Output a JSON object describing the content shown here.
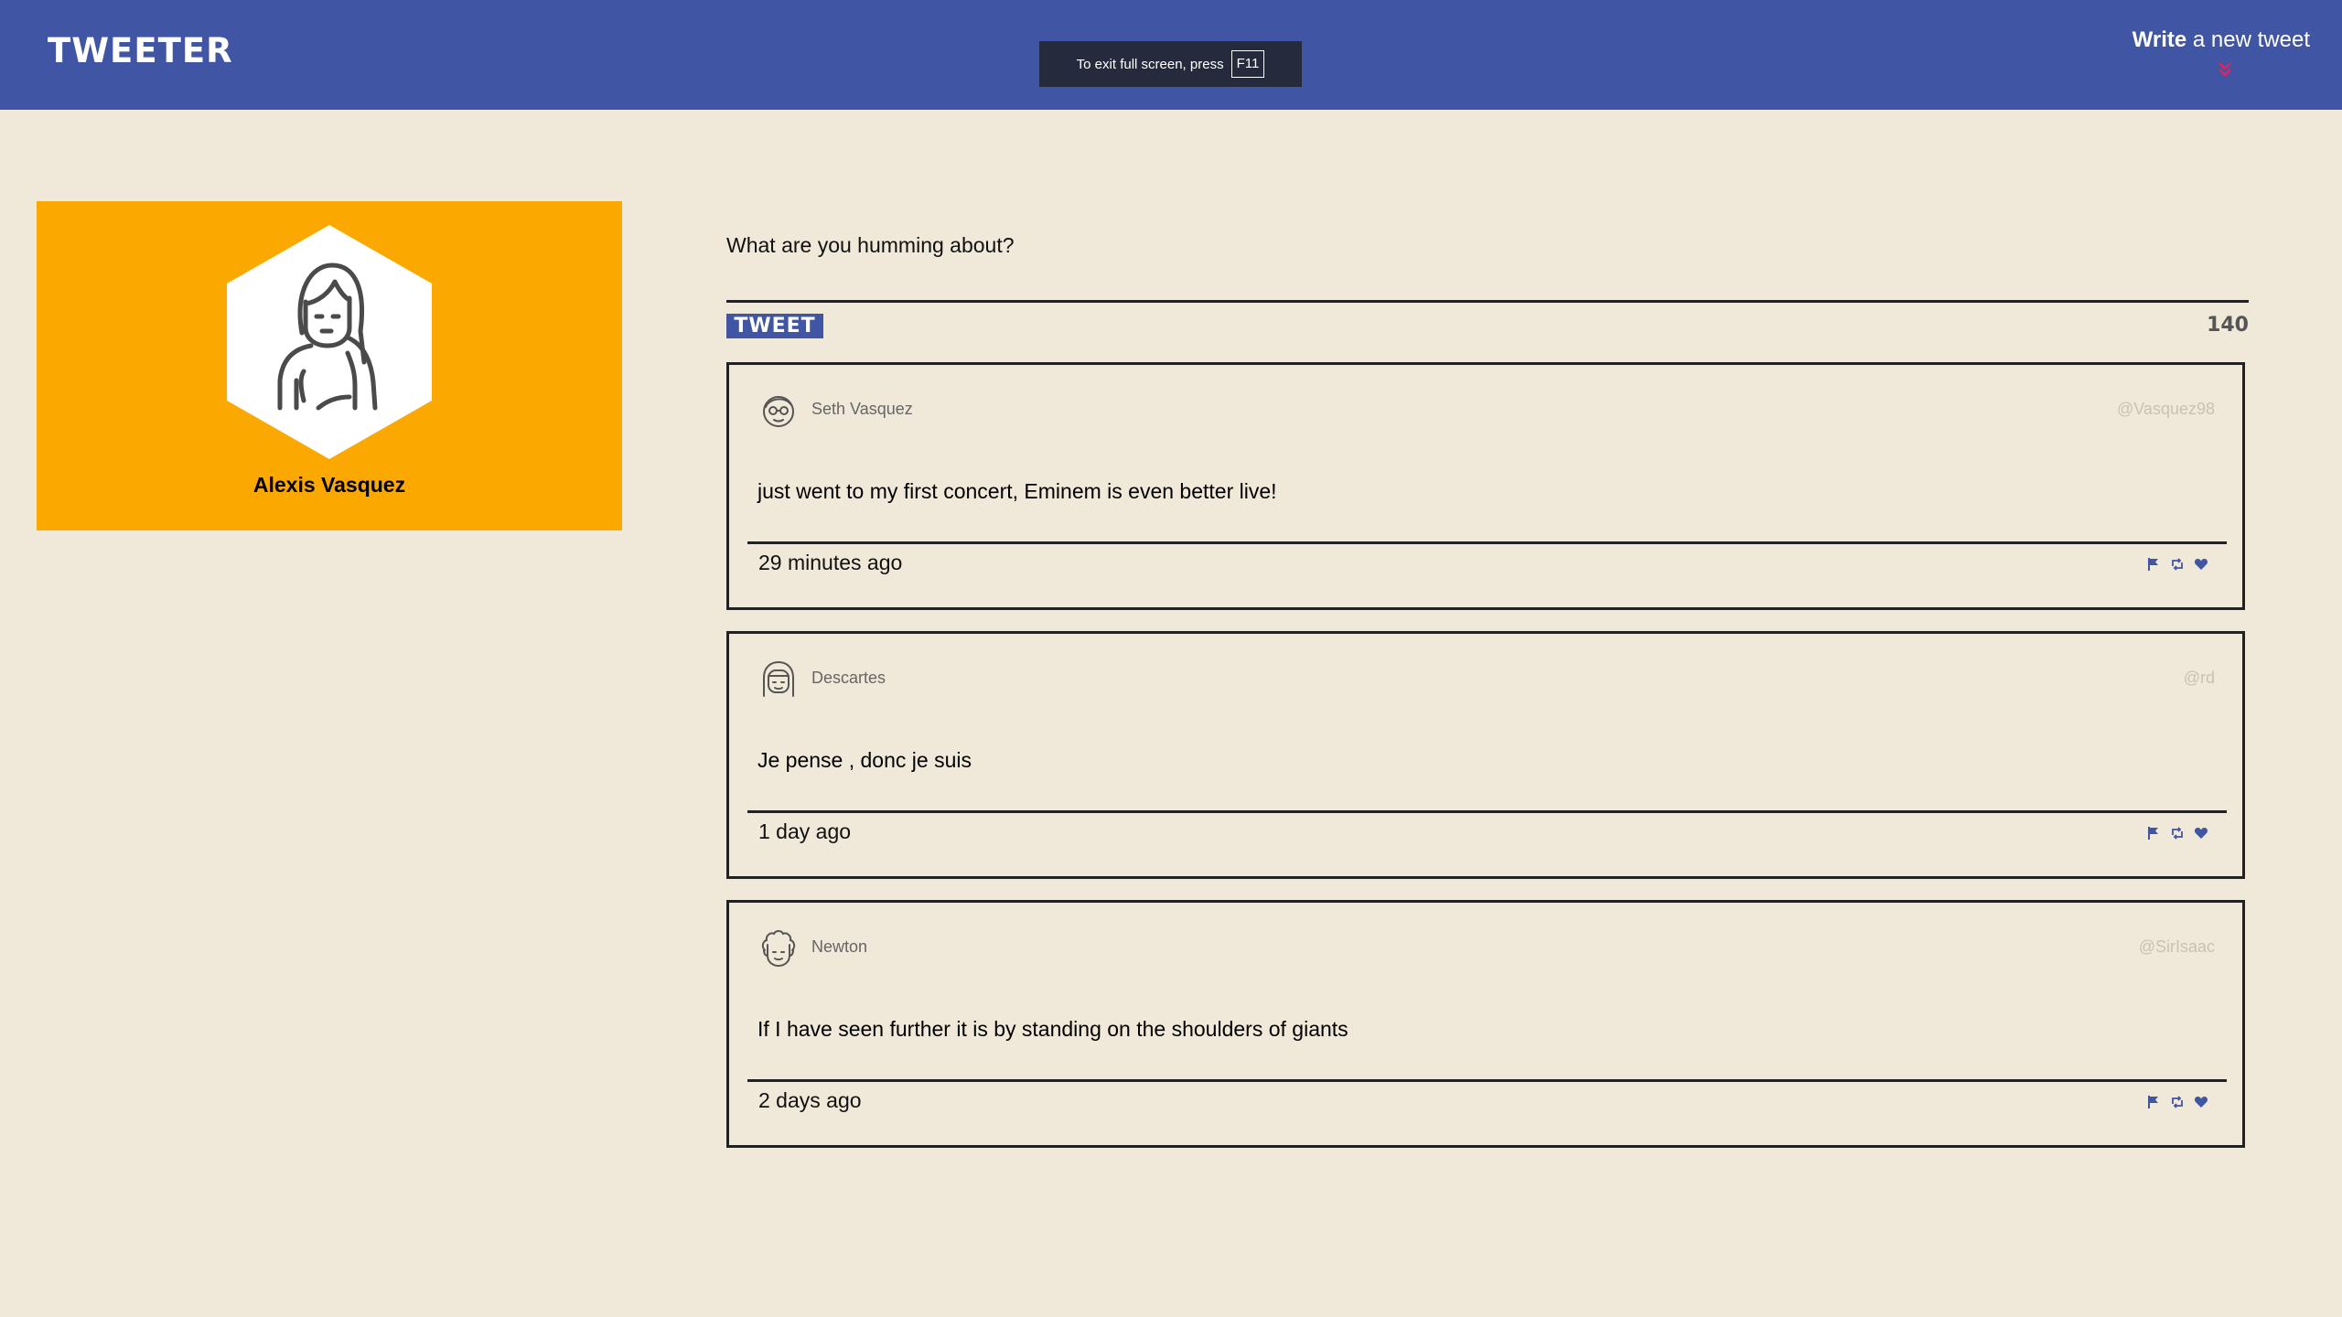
{
  "header": {
    "logo": "TWEETER",
    "fullscreen_notice": "To exit full screen, press",
    "fullscreen_key": "F11",
    "write_bold": "Write",
    "write_rest": " a new tweet",
    "accent_color": "#4055a3",
    "chevron_color": "#e0245e"
  },
  "profile": {
    "name": "Alexis Vasquez",
    "background_color": "#fba800",
    "avatar_icon": "woman-avatar-icon"
  },
  "composer": {
    "placeholder": "What are you humming about?",
    "tweet_button": "TWEET",
    "counter": "140"
  },
  "tweets": [
    {
      "author": "Seth Vasquez",
      "handle": "@Vasquez98",
      "text": "just went to my first concert, Eminem is even better live!",
      "time": "29 minutes ago",
      "avatar_icon": "glasses-man-avatar-icon"
    },
    {
      "author": "Descartes",
      "handle": "@rd",
      "text": "Je pense , donc je suis",
      "time": "1 day ago",
      "avatar_icon": "long-hair-avatar-icon"
    },
    {
      "author": "Newton",
      "handle": "@SirIsaac",
      "text": "If I have seen further it is by standing on the shoulders of giants",
      "time": "2 days ago",
      "avatar_icon": "curly-hair-avatar-icon"
    }
  ],
  "tweet_actions": [
    "flag-icon",
    "retweet-icon",
    "heart-icon"
  ]
}
